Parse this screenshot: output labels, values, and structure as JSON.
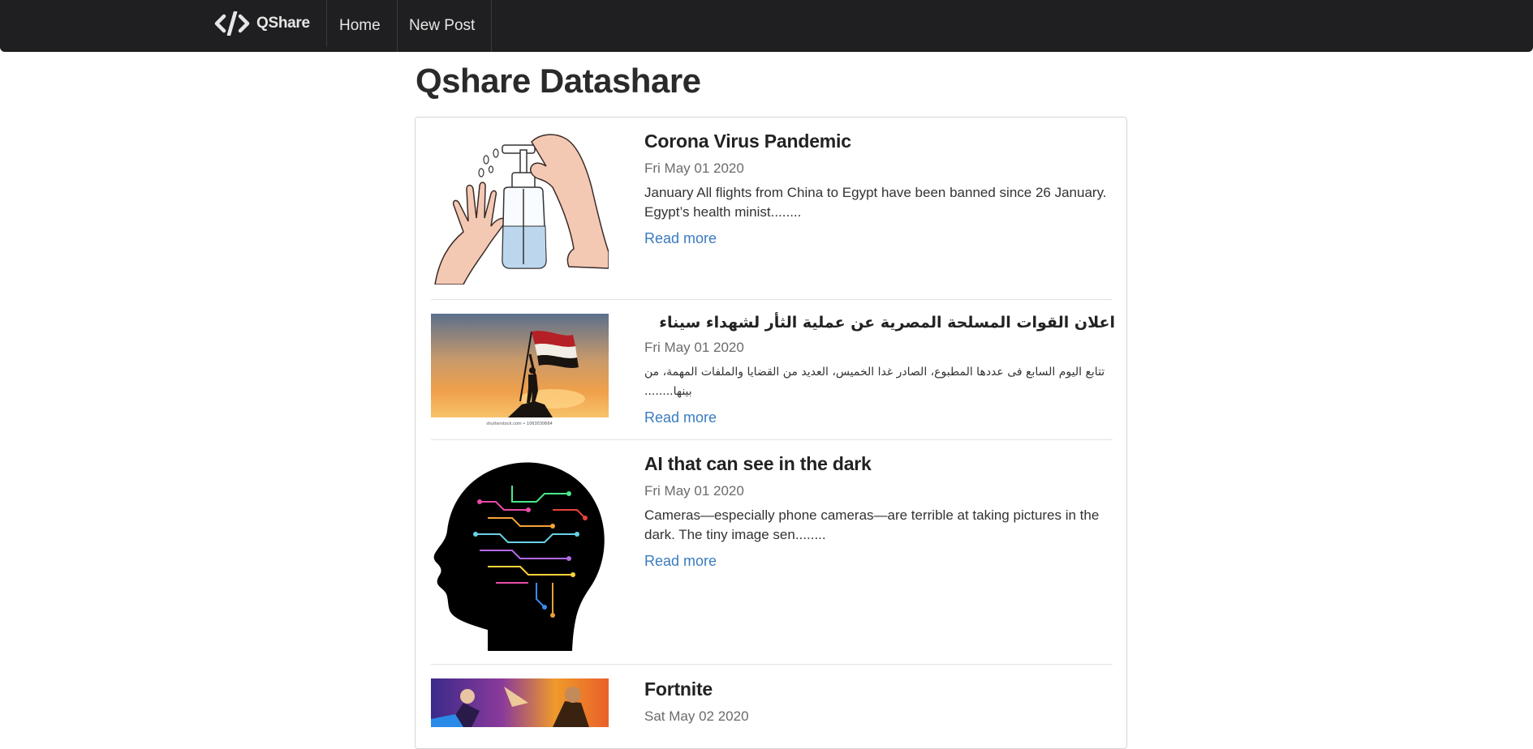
{
  "nav": {
    "brand": "QShare",
    "links": [
      "Home",
      "New Post"
    ]
  },
  "page": {
    "title": "Qshare Datashare"
  },
  "posts": [
    {
      "title": "Corona Virus Pandemic",
      "date": "Fri May 01 2020",
      "excerpt": "January All flights from China to Egypt have been banned since 26 January. Egypt’s health minist........",
      "read_more": "Read more",
      "image": "hand-sanitizer-illustration"
    },
    {
      "title": "اعلان القوات المسلحة المصرية عن عملية الثأر لشهداء سيناء",
      "date": "Fri May 01 2020",
      "excerpt": "تتابع اليوم السابع فى عددها المطبوع، الصادر غدا الخميس، العديد من القضايا والملفات المهمة، من بينها........",
      "read_more": "Read more",
      "image": "flag-silhouette-sunset-photo",
      "image_caption": "shutterstock.com • 1063030664"
    },
    {
      "title": "AI that can see in the dark",
      "date": "Fri May 01 2020",
      "excerpt": "Cameras—especially phone cameras—are terrible at taking pictures in the dark. The tiny image sen........",
      "read_more": "Read more",
      "image": "circuit-brain-head-illustration"
    },
    {
      "title": "Fortnite",
      "date": "Sat May 02 2020",
      "image": "fortnite-artwork"
    }
  ],
  "colors": {
    "navbar_bg": "#1f1f21",
    "link": "#3a7bbf",
    "date": "#6b6b6b"
  }
}
